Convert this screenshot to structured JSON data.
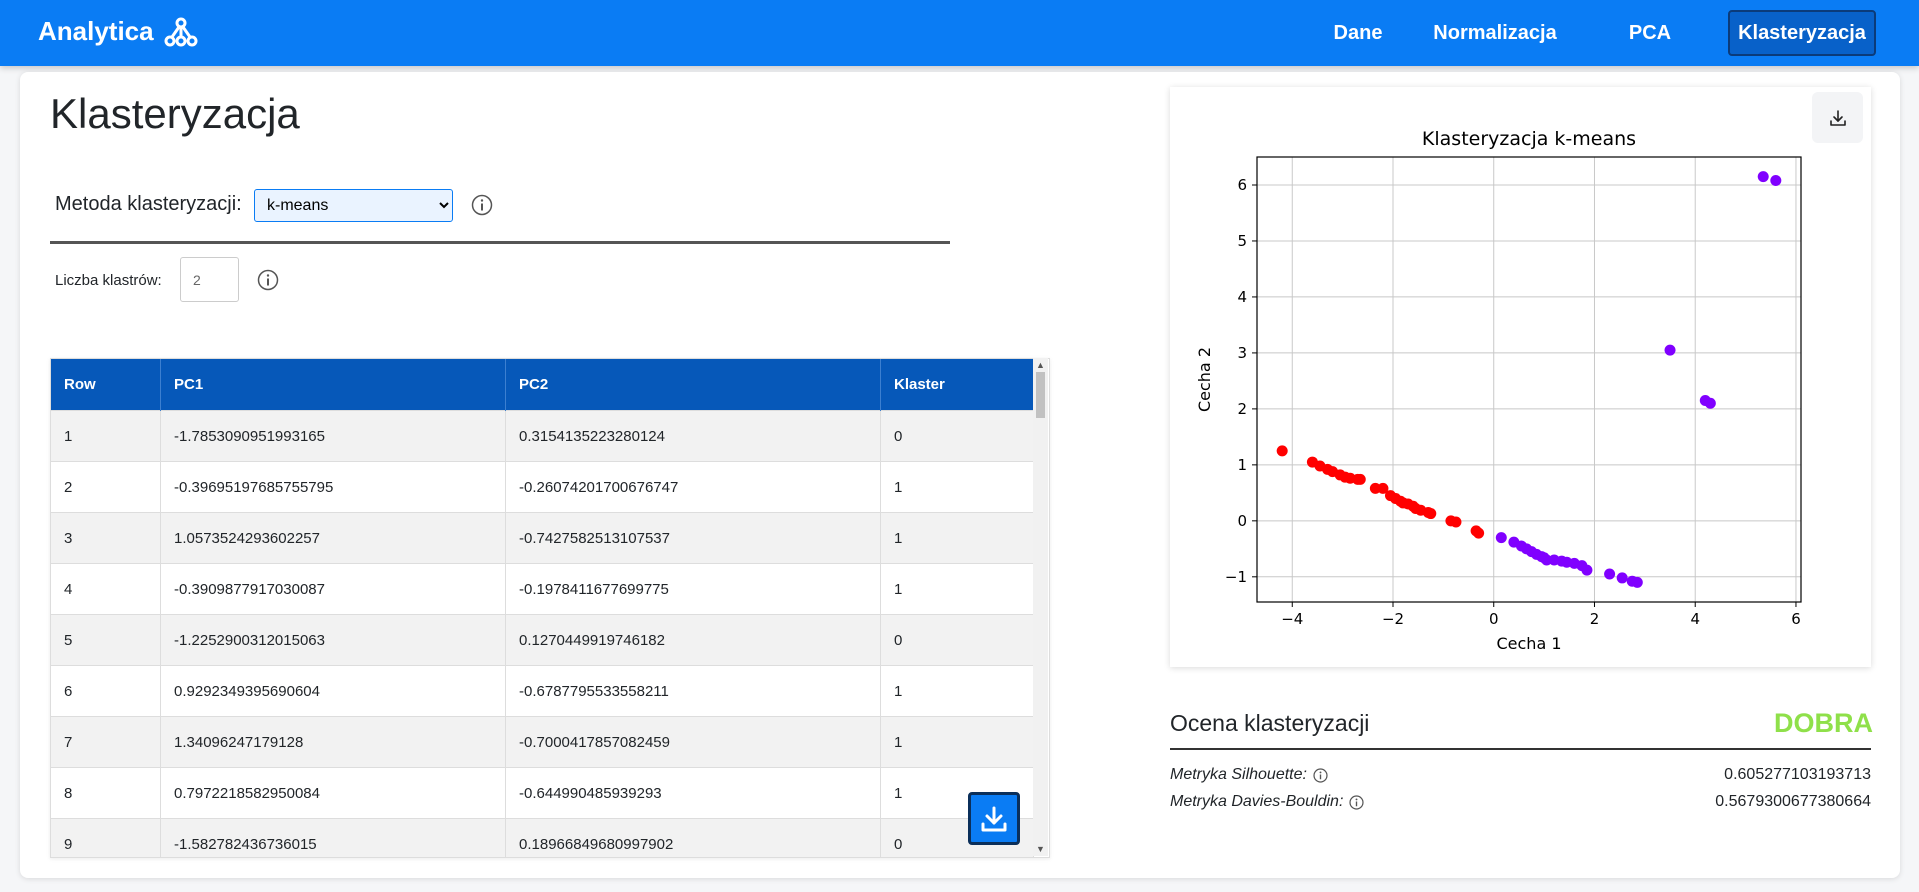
{
  "app": {
    "brand": "Analytica"
  },
  "nav": {
    "dane": "Dane",
    "normalizacja": "Normalizacja",
    "pca": "PCA",
    "klasteryzacja": "Klasteryzacja"
  },
  "page": {
    "title": "Klasteryzacja"
  },
  "method": {
    "label": "Metoda klasteryzacji:",
    "selected": "k-means"
  },
  "clusters": {
    "label": "Liczba klastrów:",
    "value": "2"
  },
  "table": {
    "headers": [
      "Row",
      "PC1",
      "PC2",
      "Klaster"
    ],
    "rows": [
      [
        "1",
        "-1.7853090951993165",
        "0.3154135223280124",
        "0"
      ],
      [
        "2",
        "-0.39695197685755795",
        "-0.26074201700676747",
        "1"
      ],
      [
        "3",
        "1.0573524293602257",
        "-0.7427582513107537",
        "1"
      ],
      [
        "4",
        "-0.3909877917030087",
        "-0.1978411677699775",
        "1"
      ],
      [
        "5",
        "-1.2252900312015063",
        "0.1270449919746182",
        "0"
      ],
      [
        "6",
        "0.9292349395690604",
        "-0.6787795533558211",
        "1"
      ],
      [
        "7",
        "1.34096247179128",
        "-0.7000417857082459",
        "1"
      ],
      [
        "8",
        "0.7972218582950084",
        "-0.644990485939293",
        "1"
      ],
      [
        "9",
        "-1.582782436736015",
        "0.18966849680997902",
        "0"
      ]
    ]
  },
  "chart_data": {
    "type": "scatter",
    "title": "Klasteryzacja k-means",
    "xlabel": "Cecha 1",
    "ylabel": "Cecha 2",
    "xlim": [
      -4.7,
      6.1
    ],
    "ylim": [
      -1.45,
      6.5
    ],
    "xticks": [
      -4,
      -2,
      0,
      2,
      4,
      6
    ],
    "yticks": [
      -1,
      0,
      1,
      2,
      3,
      4,
      5,
      6
    ],
    "grid": true,
    "colors": {
      "0": "#ff0000",
      "1": "#8000ff"
    },
    "series": [
      {
        "cluster": 0,
        "points": [
          [
            -4.2,
            1.25
          ],
          [
            -3.6,
            1.05
          ],
          [
            -3.45,
            0.98
          ],
          [
            -3.3,
            0.92
          ],
          [
            -3.2,
            0.88
          ],
          [
            -3.05,
            0.82
          ],
          [
            -2.95,
            0.78
          ],
          [
            -2.85,
            0.76
          ],
          [
            -2.7,
            0.74
          ],
          [
            -2.65,
            0.74
          ],
          [
            -2.35,
            0.58
          ],
          [
            -2.2,
            0.58
          ],
          [
            -2.05,
            0.45
          ],
          [
            -1.95,
            0.4
          ],
          [
            -1.85,
            0.35
          ],
          [
            -1.8,
            0.32
          ],
          [
            -1.7,
            0.3
          ],
          [
            -1.6,
            0.26
          ],
          [
            -1.55,
            0.22
          ],
          [
            -1.45,
            0.19
          ],
          [
            -1.3,
            0.15
          ],
          [
            -1.25,
            0.13
          ],
          [
            -0.85,
            0.0
          ],
          [
            -0.75,
            -0.02
          ],
          [
            -0.35,
            -0.18
          ],
          [
            -0.3,
            -0.22
          ]
        ]
      },
      {
        "cluster": 1,
        "points": [
          [
            0.15,
            -0.3
          ],
          [
            0.4,
            -0.38
          ],
          [
            0.55,
            -0.45
          ],
          [
            0.65,
            -0.5
          ],
          [
            0.75,
            -0.55
          ],
          [
            0.85,
            -0.6
          ],
          [
            0.95,
            -0.64
          ],
          [
            1.0,
            -0.66
          ],
          [
            1.05,
            -0.7
          ],
          [
            1.2,
            -0.7
          ],
          [
            1.35,
            -0.72
          ],
          [
            1.45,
            -0.74
          ],
          [
            1.6,
            -0.76
          ],
          [
            1.75,
            -0.8
          ],
          [
            1.85,
            -0.88
          ],
          [
            2.3,
            -0.95
          ],
          [
            2.55,
            -1.02
          ],
          [
            2.75,
            -1.08
          ],
          [
            2.85,
            -1.1
          ],
          [
            3.5,
            3.05
          ],
          [
            4.2,
            2.15
          ],
          [
            4.3,
            2.1
          ],
          [
            5.35,
            6.15
          ],
          [
            5.6,
            6.08
          ]
        ]
      }
    ]
  },
  "evaluation": {
    "title": "Ocena klasteryzacji",
    "badge": "DOBRA",
    "silhouette_label": "Metryka Silhouette:",
    "silhouette_value": "0.605277103193713",
    "db_label": "Metryka Davies-Bouldin:",
    "db_value": "0.5679300677380664"
  }
}
